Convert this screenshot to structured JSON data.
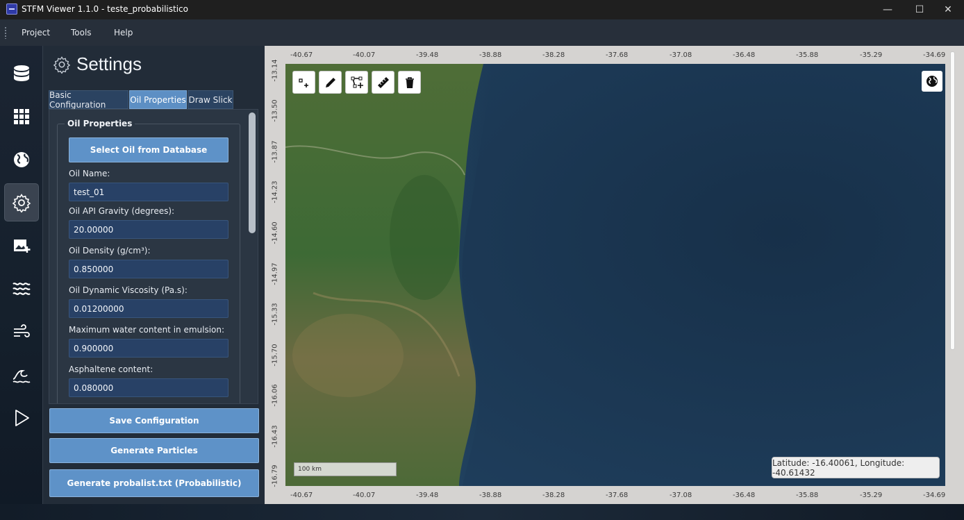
{
  "window": {
    "title": "STFM Viewer 1.1.0 - teste_probabilistico",
    "minimize_glyph": "—",
    "maximize_glyph": "☐",
    "close_glyph": "✕"
  },
  "menu": {
    "items": [
      "Project",
      "Tools",
      "Help"
    ]
  },
  "sidebar": {
    "icons": [
      "database-icon",
      "grid-icon",
      "globe-icon",
      "gear-icon",
      "image-add-icon",
      "waves-icon",
      "wind-icon",
      "ocean-wave-icon",
      "play-icon"
    ],
    "active": "gear-icon"
  },
  "settings": {
    "title": "Settings",
    "tabs": [
      "Basic Configuration",
      "Oil Properties",
      "Draw Slick"
    ],
    "selected_tab": "Oil Properties",
    "group_title": "Oil Properties",
    "select_button": "Select Oil from Database",
    "fields": [
      {
        "label": "Oil Name:",
        "value": "test_01"
      },
      {
        "label": "Oil API Gravity (degrees):",
        "value": "20.00000"
      },
      {
        "label": "Oil Density (g/cm³):",
        "value": "0.850000"
      },
      {
        "label": "Oil Dynamic Viscosity (Pa.s):",
        "value": "0.01200000"
      },
      {
        "label": "Maximum water content in emulsion:",
        "value": "0.900000"
      },
      {
        "label": "Asphaltene content:",
        "value": "0.080000"
      }
    ],
    "buttons": {
      "save": "Save Configuration",
      "generate": "Generate Particles",
      "probalist": "Generate probalist.txt (Probabilistic)"
    }
  },
  "map": {
    "lon_ticks": [
      "-40.67",
      "-40.07",
      "-39.48",
      "-38.88",
      "-38.28",
      "-37.68",
      "-37.08",
      "-36.48",
      "-35.88",
      "-35.29",
      "-34.69"
    ],
    "lat_ticks": [
      "-13.14",
      "-13.50",
      "-13.87",
      "-14.23",
      "-14.60",
      "-14.97",
      "-15.33",
      "-15.70",
      "-16.06",
      "-16.43",
      "-16.79"
    ],
    "tools": [
      "add-point-icon",
      "pencil-icon",
      "polygon-add-icon",
      "ruler-icon",
      "trash-icon"
    ],
    "scale_label": "100 km",
    "coordinates": "Latitude: -16.40061, Longitude: -40.61432",
    "colors": {
      "ocean": "#1e3a55",
      "land": "#4d6b3a"
    }
  }
}
